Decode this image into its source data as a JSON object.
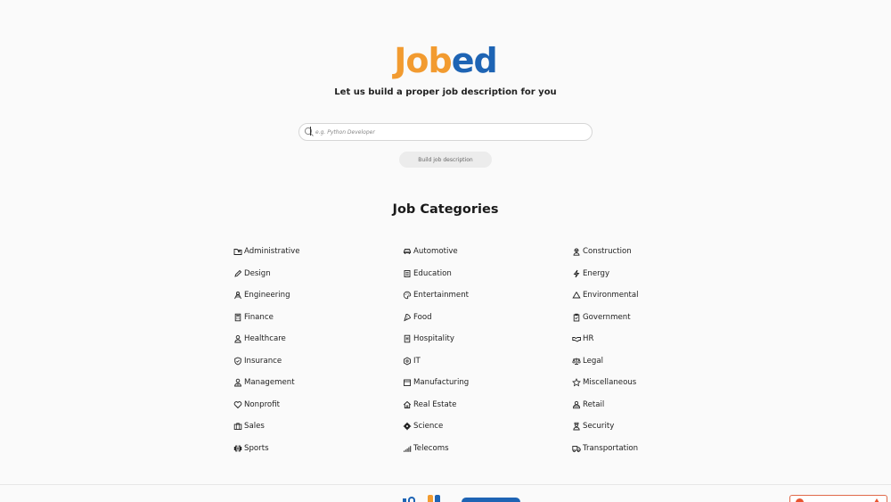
{
  "logo": {
    "part1": "Job",
    "part2": "ed"
  },
  "tagline": "Let us build a proper job description for you",
  "search": {
    "placeholder": "e.g. Python Developer",
    "value": ""
  },
  "build_button": "Build job description",
  "categories_title": "Job Categories",
  "categories": [
    {
      "label": "Administrative",
      "icon": "folder-icon"
    },
    {
      "label": "Automotive",
      "icon": "car-icon"
    },
    {
      "label": "Construction",
      "icon": "worker-icon"
    },
    {
      "label": "Design",
      "icon": "pencil-icon"
    },
    {
      "label": "Education",
      "icon": "book-icon"
    },
    {
      "label": "Energy",
      "icon": "bolt-icon"
    },
    {
      "label": "Engineering",
      "icon": "engineer-icon"
    },
    {
      "label": "Entertainment",
      "icon": "palette-icon"
    },
    {
      "label": "Environmental",
      "icon": "recycle-icon"
    },
    {
      "label": "Finance",
      "icon": "calculator-icon"
    },
    {
      "label": "Food",
      "icon": "food-icon"
    },
    {
      "label": "Government",
      "icon": "clipboard-icon"
    },
    {
      "label": "Healthcare",
      "icon": "user-icon"
    },
    {
      "label": "Hospitality",
      "icon": "hotel-icon"
    },
    {
      "label": "HR",
      "icon": "handshake-icon"
    },
    {
      "label": "Insurance",
      "icon": "shield-check-icon"
    },
    {
      "label": "IT",
      "icon": "hexagon-icon"
    },
    {
      "label": "Legal",
      "icon": "scale-icon"
    },
    {
      "label": "Management",
      "icon": "manager-icon"
    },
    {
      "label": "Manufacturing",
      "icon": "factory-icon"
    },
    {
      "label": "Miscellaneous",
      "icon": "star-icon"
    },
    {
      "label": "Nonprofit",
      "icon": "heart-icon"
    },
    {
      "label": "Real Estate",
      "icon": "house-icon"
    },
    {
      "label": "Retail",
      "icon": "cashier-icon"
    },
    {
      "label": "Sales",
      "icon": "briefcase-icon"
    },
    {
      "label": "Science",
      "icon": "atom-icon"
    },
    {
      "label": "Security",
      "icon": "guard-icon"
    },
    {
      "label": "Sports",
      "icon": "dumbbell-icon"
    },
    {
      "label": "Telecoms",
      "icon": "signal-icon"
    },
    {
      "label": "Transportation",
      "icon": "truck-icon"
    }
  ],
  "colors": {
    "logo_orange": "#f29b30",
    "logo_blue": "#1e64b4",
    "featured_red": "#e8542f"
  }
}
